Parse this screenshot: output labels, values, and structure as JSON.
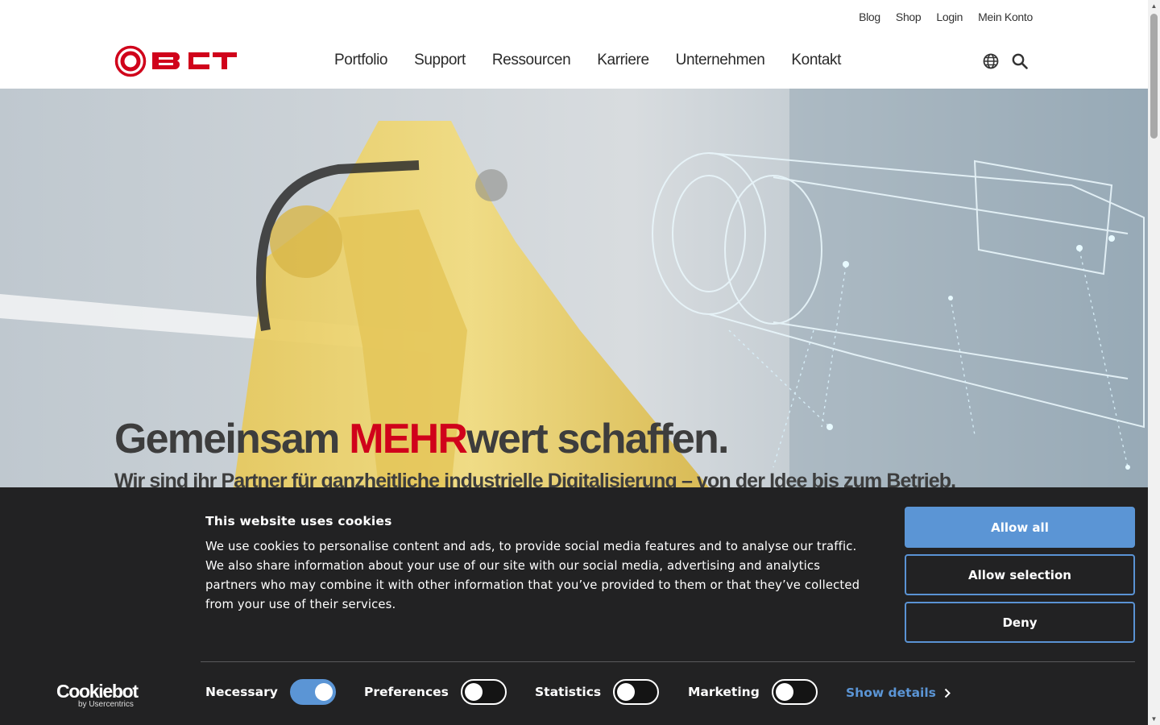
{
  "header": {
    "util_nav": [
      "Blog",
      "Shop",
      "Login",
      "Mein Konto"
    ],
    "logo_text": "BCT",
    "main_nav": [
      "Portfolio",
      "Support",
      "Ressourcen",
      "Karriere",
      "Unternehmen",
      "Kontakt"
    ],
    "icons": [
      "globe-icon",
      "search-icon"
    ],
    "brand_color": "#d0021b"
  },
  "hero": {
    "title_prefix": "Gemeinsam ",
    "title_accent": "MEHR",
    "title_suffix": "wert schaffen.",
    "subtitle": "Wir sind ihr Partner für ganzheitliche industrielle Digitalisierung – von der Idee bis zum Betrieb."
  },
  "cookie": {
    "title": "This website uses cookies",
    "text": "We use cookies to personalise content and ads, to provide social media features and to analyse our traffic. We also share information about your use of our site with our social media, advertising and analytics partners who may combine it with other information that you’ve provided to them or that they’ve collected from your use of their services.",
    "buttons": {
      "allow_all": "Allow all",
      "allow_selection": "Allow selection",
      "deny": "Deny"
    },
    "brand": {
      "name": "Cookiebot",
      "sub": "by Usercentrics"
    },
    "toggles": {
      "necessary": {
        "label": "Necessary",
        "on": true
      },
      "preferences": {
        "label": "Preferences",
        "on": false
      },
      "statistics": {
        "label": "Statistics",
        "on": false
      },
      "marketing": {
        "label": "Marketing",
        "on": false
      }
    },
    "show_details": "Show details",
    "accent_color": "#5b95d5",
    "background": "#222223"
  }
}
